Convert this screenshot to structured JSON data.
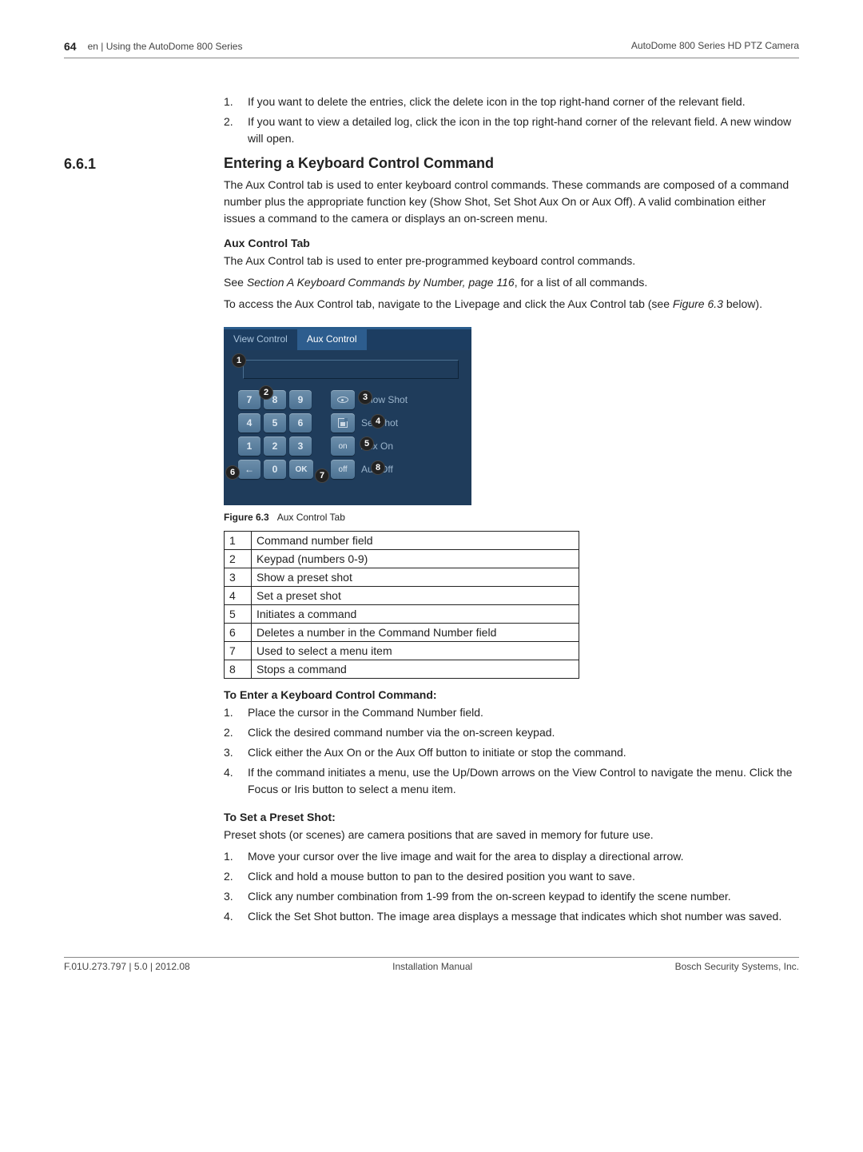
{
  "header": {
    "page_number": "64",
    "left_text": "en | Using the AutoDome 800 Series",
    "right_text": "AutoDome 800 Series HD PTZ Camera"
  },
  "intro_list": [
    "If you want to delete the entries, click the delete icon in the top right-hand corner of the relevant field.",
    "If you want to view a detailed log, click the icon in the top right-hand corner of the relevant field. A new window will open."
  ],
  "section_number": "6.6.1",
  "section_title": "Entering a Keyboard Control Command",
  "intro_para": "The Aux Control tab is used to enter keyboard control commands. These commands are composed of a command number plus the appropriate function key (Show Shot, Set Shot Aux On or Aux Off). A valid combination either issues a command to the camera or displays an on-screen menu.",
  "aux_heading": "Aux Control Tab",
  "aux_para_1": "The Aux Control tab is used to enter pre-programmed keyboard control commands.",
  "aux_para_see_prefix": "See ",
  "aux_para_see_italic": "Section A Keyboard Commands by Number, page 116",
  "aux_para_see_suffix": ", for a list of all commands.",
  "aux_para_2_prefix": "To access the Aux Control tab, navigate to the Livepage and click the Aux Control tab (see ",
  "aux_para_2_italic": "Figure 6.3",
  "aux_para_2_suffix": " below).",
  "figure": {
    "tab_view": "View Control",
    "tab_aux": "Aux Control",
    "keypad": [
      [
        "7",
        "8",
        "9"
      ],
      [
        "4",
        "5",
        "6"
      ],
      [
        "1",
        "2",
        "3"
      ],
      [
        "←",
        "0",
        "OK"
      ]
    ],
    "side": [
      {
        "btn": "eye",
        "label": "Show Shot"
      },
      {
        "btn": "disk",
        "label": "Set Shot"
      },
      {
        "btn": "on",
        "label": "Aux On"
      },
      {
        "btn": "off",
        "label": "Aux Off"
      }
    ],
    "caption_bold": "Figure  6.3",
    "caption_text": "Aux Control Tab"
  },
  "legend": [
    {
      "n": "1",
      "d": "Command number field"
    },
    {
      "n": "2",
      "d": "Keypad (numbers 0-9)"
    },
    {
      "n": "3",
      "d": "Show a preset shot"
    },
    {
      "n": "4",
      "d": "Set a preset shot"
    },
    {
      "n": "5",
      "d": "Initiates a command"
    },
    {
      "n": "6",
      "d": "Deletes a number in the Command Number field"
    },
    {
      "n": "7",
      "d": "Used to select a menu item"
    },
    {
      "n": "8",
      "d": "Stops a command"
    }
  ],
  "enter_heading": "To Enter a Keyboard Control Command:",
  "enter_list": [
    "Place the cursor in the Command Number field.",
    "Click the desired command number via the on-screen keypad.",
    "Click either the Aux On or the Aux Off button to initiate or stop the command.",
    "If the command initiates a menu, use the Up/Down arrows on the View Control to navigate the menu. Click the Focus or Iris button to select a menu item."
  ],
  "preset_heading": "To Set a Preset Shot:",
  "preset_intro": "Preset shots (or scenes) are camera positions that are saved in memory for future use.",
  "preset_list": [
    "Move your cursor over the live image and wait for the area to display a directional arrow.",
    "Click and hold a mouse button to pan to the desired position you want to save.",
    "Click any number combination from 1-99 from the on-screen keypad to identify the scene number.",
    "Click the Set Shot button. The image area displays a message that indicates which shot number was saved."
  ],
  "footer": {
    "left": "F.01U.273.797 | 5.0 | 2012.08",
    "center": "Installation Manual",
    "right": "Bosch Security Systems, Inc."
  }
}
